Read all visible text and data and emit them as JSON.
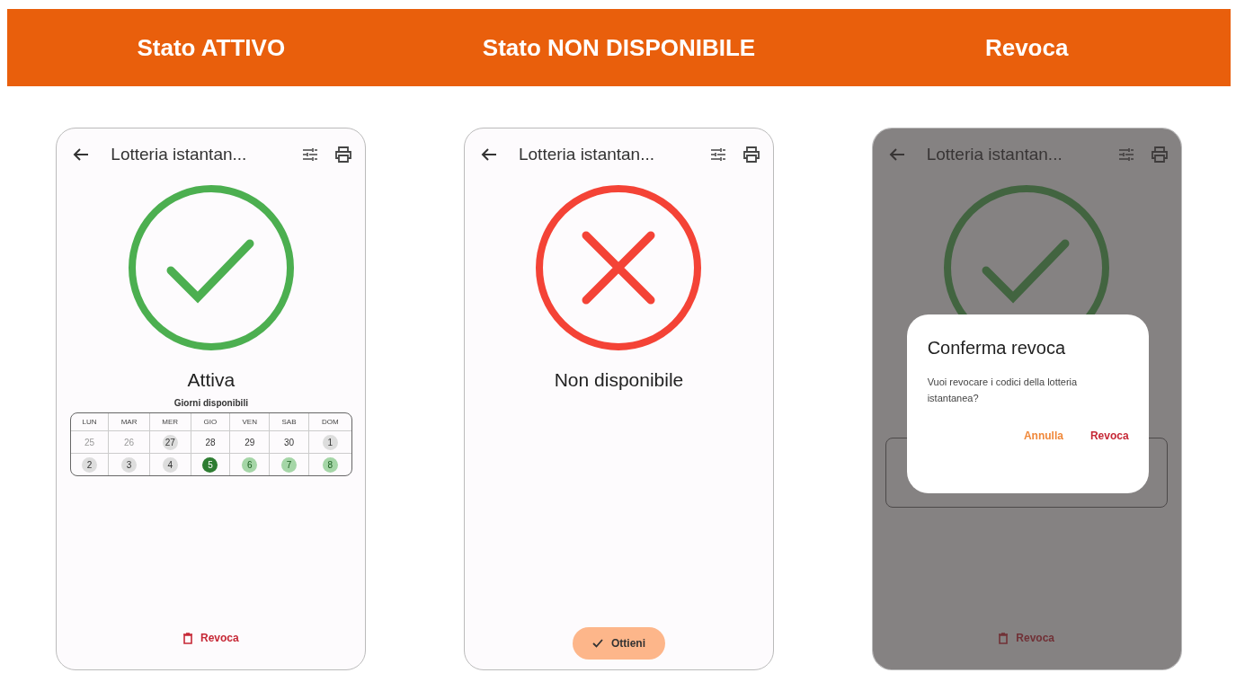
{
  "header": {
    "columns": [
      "Stato ATTIVO",
      "Stato NON DISPONIBILE",
      "Revoca"
    ]
  },
  "phones": [
    {
      "dimmed": false,
      "app_bar": {
        "title": "Lotteria istantan..."
      },
      "status": {
        "kind": "active",
        "label": "Attiva"
      },
      "calendar": {
        "title": "Giorni disponibili",
        "days": [
          "LUN",
          "MAR",
          "MER",
          "GIO",
          "VEN",
          "SAB",
          "DOM"
        ],
        "weeks": [
          [
            {
              "day": "25",
              "kind": "past"
            },
            {
              "day": "26",
              "kind": "past"
            },
            {
              "day": "27",
              "kind": "disabled"
            },
            {
              "day": "28",
              "kind": "default"
            },
            {
              "day": "29",
              "kind": "default"
            },
            {
              "day": "30",
              "kind": "default"
            },
            {
              "day": "1",
              "kind": "disabled"
            }
          ],
          [
            {
              "day": "2",
              "kind": "disabled"
            },
            {
              "day": "3",
              "kind": "disabled"
            },
            {
              "day": "4",
              "kind": "disabled"
            },
            {
              "day": "5",
              "kind": "today"
            },
            {
              "day": "6",
              "kind": "available"
            },
            {
              "day": "7",
              "kind": "available"
            },
            {
              "day": "8",
              "kind": "available"
            }
          ]
        ]
      },
      "action": {
        "kind": "text",
        "label": "Revoca"
      }
    },
    {
      "dimmed": false,
      "app_bar": {
        "title": "Lotteria istantan..."
      },
      "status": {
        "kind": "unavailable",
        "label": "Non disponibile"
      },
      "action": {
        "kind": "filled",
        "label": "Ottieni"
      }
    },
    {
      "dimmed": true,
      "app_bar": {
        "title": "Lotteria istantan..."
      },
      "status": {
        "kind": "active"
      },
      "hidden_calendar": true,
      "action": {
        "kind": "text",
        "label": "Revoca"
      },
      "dialog": {
        "title": "Conferma revoca",
        "message": "Vuoi revocare i codici della lotteria istantanea?",
        "buttons": [
          {
            "label": "Annulla",
            "kind": "neutral"
          },
          {
            "label": "Revoca",
            "kind": "destructive"
          }
        ]
      }
    }
  ]
}
